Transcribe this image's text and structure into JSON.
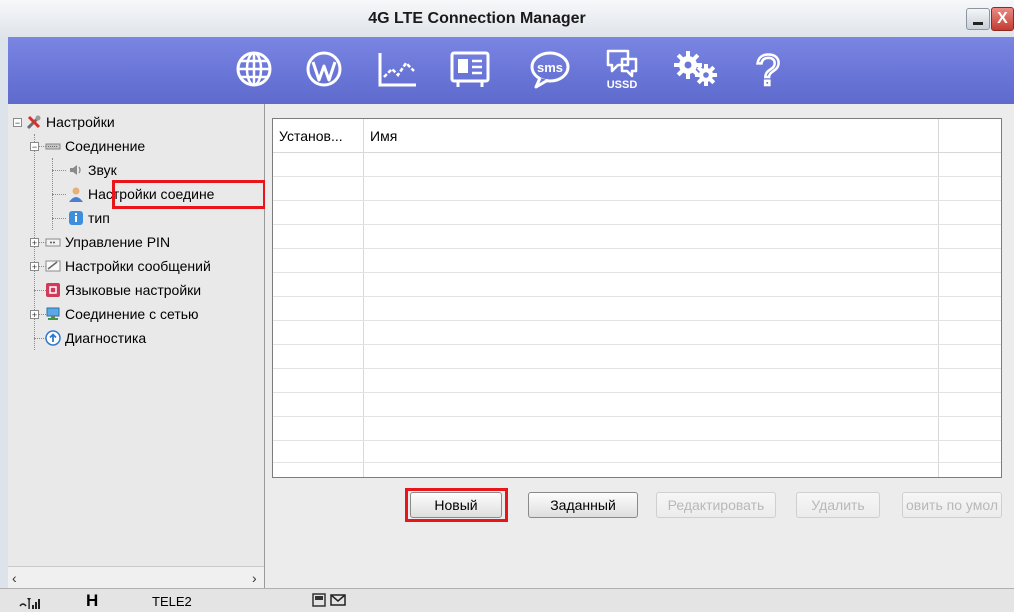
{
  "window": {
    "title": "4G LTE Connection Manager",
    "minimize_label": "_",
    "close_label": "X"
  },
  "toolbar": {
    "icons": [
      "internet-icon",
      "wordpress-icon",
      "statistics-icon",
      "contacts-icon",
      "sms-icon",
      "ussd-icon",
      "settings-gears-icon",
      "help-icon"
    ],
    "sms_text": "sms",
    "ussd_text": "USSD",
    "help_text": "?"
  },
  "tree": {
    "root": "Настройки",
    "connection": "Соединение",
    "sound": "Звук",
    "connection_settings": "Настройки соедине",
    "type": "тип",
    "pin": "Управление PIN",
    "messages": "Настройки сообщений",
    "language": "Языковые настройки",
    "network": "Соединение с сетью",
    "diagnostics": "Диагностика"
  },
  "grid": {
    "columns": [
      "Установ...",
      "Имя"
    ]
  },
  "buttons": {
    "new": "Новый",
    "default": "Заданный",
    "edit": "Редактировать",
    "delete": "Удалить",
    "restore": "овить по умол"
  },
  "status": {
    "network_type": "H",
    "operator": "TELE2"
  },
  "colors": {
    "toolbar": "#6b77d8",
    "highlight": "#e8151b"
  }
}
